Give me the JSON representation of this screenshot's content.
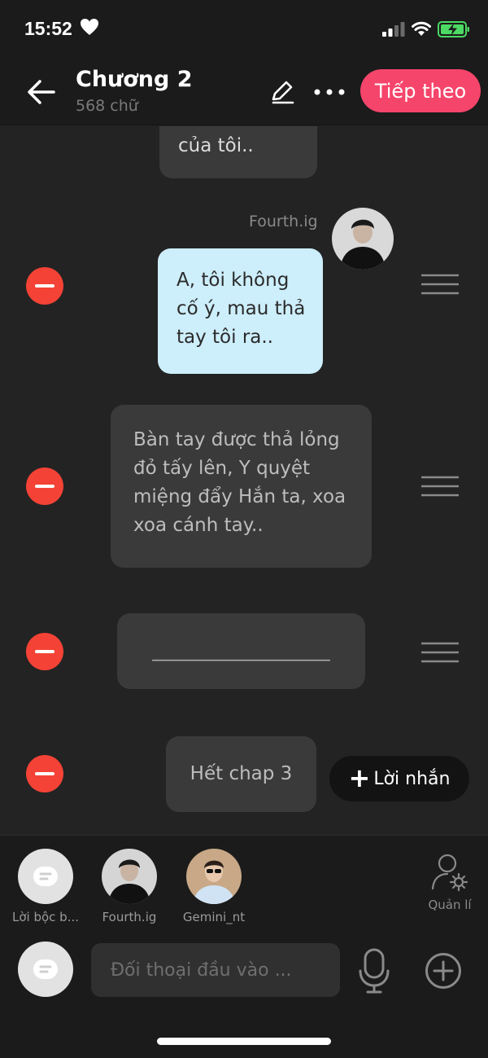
{
  "status_bar": {
    "time": "15:52"
  },
  "header": {
    "title": "Chương 2",
    "subtitle": "568 chữ",
    "next_label": "Tiếp theo"
  },
  "chat": {
    "partial_message": "của tôi..",
    "sender_name": "Fourth.ig",
    "blue_message_lines": [
      "A, tôi không",
      "cố ý, mau thả",
      "tay tôi ra.."
    ],
    "narration_lines": [
      "Bàn tay được thả lỏng",
      "đỏ tấy lên, Y quyệt",
      "miệng đẩy Hắn ta, xoa",
      "xoa cánh tay.."
    ],
    "divider_message": "___________________",
    "end_message": "Hết chap 3",
    "note_button_label": "Lời nhắn"
  },
  "characters": [
    {
      "name": "Lời bộc b..."
    },
    {
      "name": "Fourth.ig"
    },
    {
      "name": "Gemini_nt"
    }
  ],
  "manage_label": "Quản lí",
  "input": {
    "placeholder": "Đối thoại đầu vào ..."
  },
  "colors": {
    "accent": "#f5456b",
    "remove": "#f44336",
    "blue_bubble": "#cdeefb",
    "background": "#232323"
  }
}
